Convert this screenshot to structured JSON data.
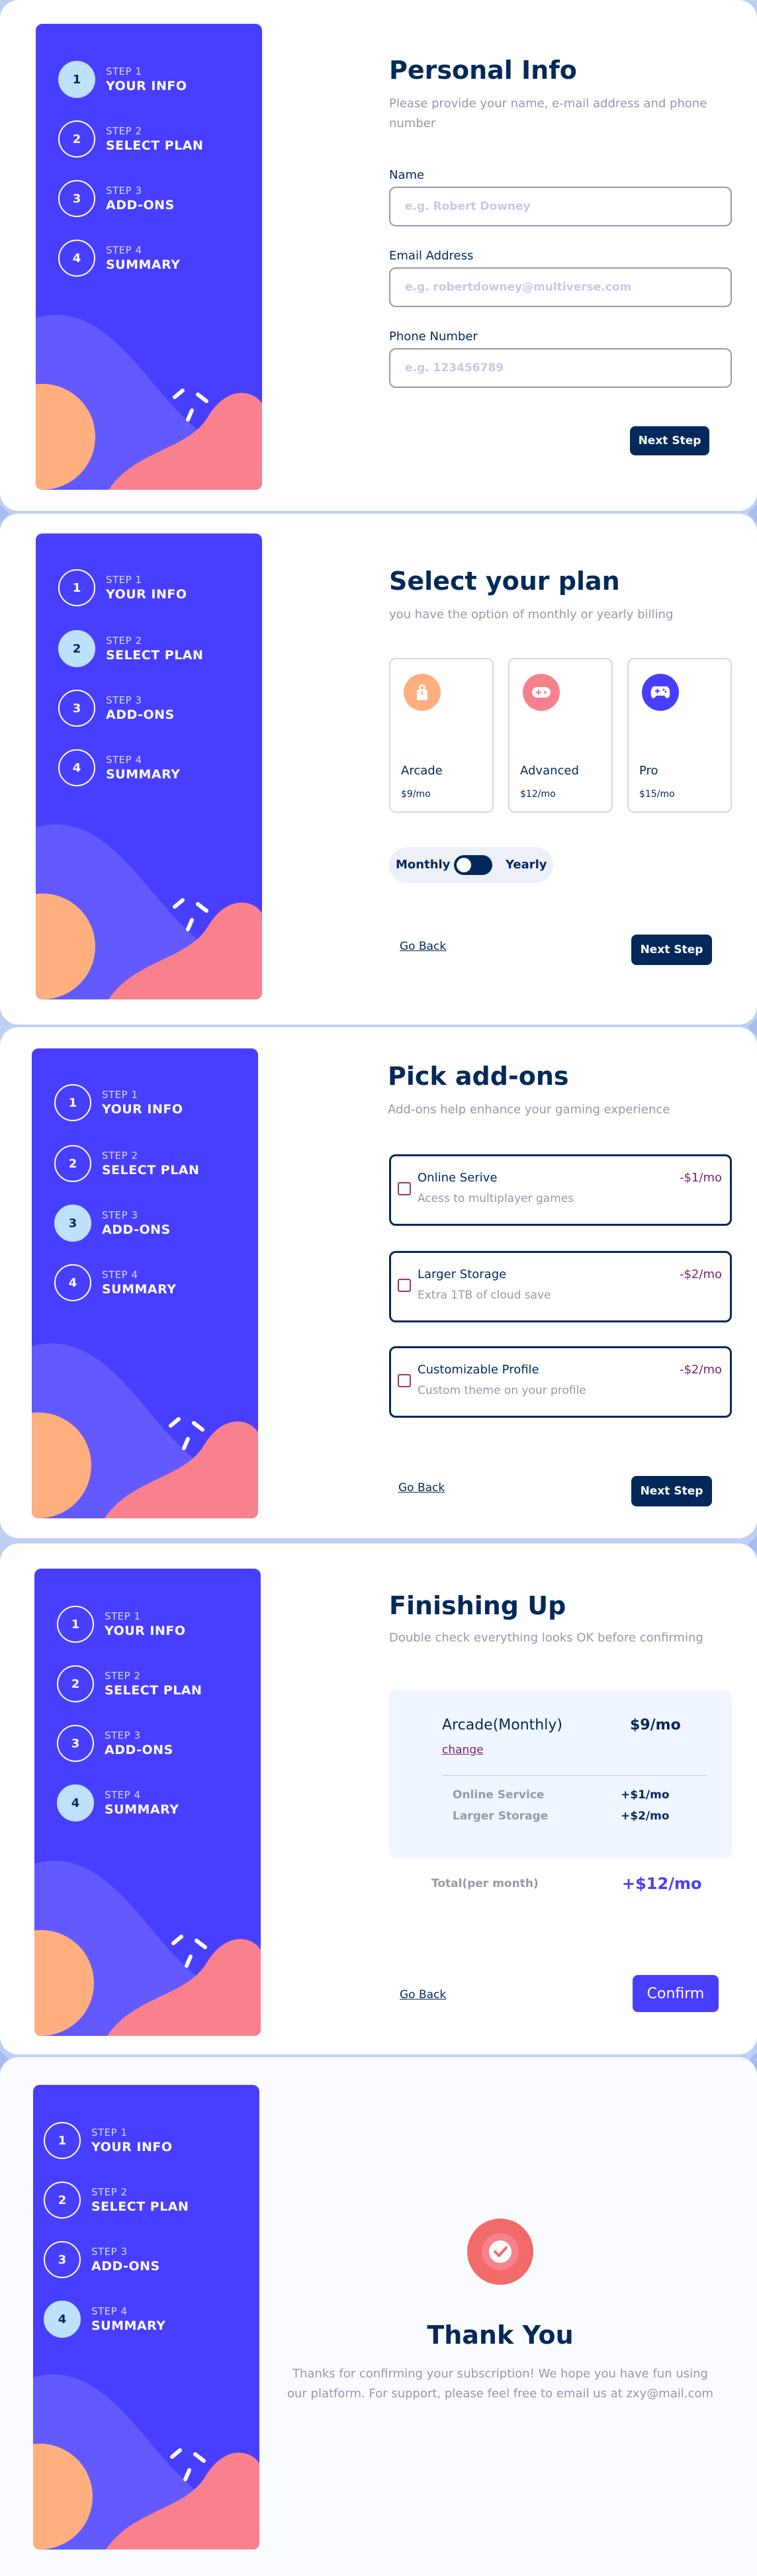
{
  "steps": [
    {
      "step": "STEP 1",
      "title": "YOUR INFO",
      "num": "1"
    },
    {
      "step": "STEP 2",
      "title": "SELECT PLAN",
      "num": "2"
    },
    {
      "step": "STEP 3",
      "title": "ADD-ONS",
      "num": "3"
    },
    {
      "step": "STEP 4",
      "title": "SUMMARY",
      "num": "4"
    }
  ],
  "personal": {
    "title": "Personal Info",
    "subtitle": "Please provide your name, e-mail address and phone number",
    "name_label": "Name",
    "name_placeholder": "e.g. Robert Downey",
    "email_label": "Email Address",
    "email_placeholder": "e.g. robertdowney@multiverse.com",
    "phone_label": "Phone Number",
    "phone_placeholder": "e.g. 123456789",
    "next_label": "Next Step"
  },
  "plan": {
    "title": "Select your plan",
    "subtitle": "you have the option of monthly or yearly billing",
    "options": [
      {
        "name": "Arcade",
        "price": "$9/mo",
        "icon": "arcade-icon",
        "color": "#ffaf7e"
      },
      {
        "name": "Advanced",
        "price": "$12/mo",
        "icon": "advanced-icon",
        "color": "#f9818e"
      },
      {
        "name": "Pro",
        "price": "$15/mo",
        "icon": "pro-icon",
        "color": "#483eff"
      }
    ],
    "monthly_label": "Monthly",
    "yearly_label": "Yearly",
    "back_label": "Go Back",
    "next_label": "Next Step"
  },
  "addons": {
    "title": "Pick add-ons",
    "subtitle": "Add-ons help enhance your gaming experience",
    "items": [
      {
        "name": "Online Serive",
        "desc": "Acess to multiplayer games",
        "price": "-$1/mo"
      },
      {
        "name": "Larger Storage",
        "desc": "Extra 1TB of cloud save",
        "price": "-$2/mo"
      },
      {
        "name": "Customizable Profile",
        "desc": "Custom theme on your profile",
        "price": "-$2/mo"
      }
    ],
    "back_label": "Go Back",
    "next_label": "Next Step"
  },
  "summary": {
    "title": "Finishing Up",
    "subtitle": "Double check everything looks OK before confirming",
    "plan_name": "Arcade(Monthly)",
    "plan_price": "$9/mo",
    "change_label": "change",
    "lines": [
      {
        "name": "Online Service",
        "price": "+$1/mo"
      },
      {
        "name": "Larger Storage",
        "price": "+$2/mo"
      }
    ],
    "total_label": "Total(per month)",
    "total_value": "+$12/mo",
    "back_label": "Go Back",
    "confirm_label": "Confirm"
  },
  "thankyou": {
    "title": "Thank You",
    "message": "Thanks for confirming your subscription! We hope you have fun using our platform. For support, please feel free to email us at zxy@mail.com",
    "icon": "checkmark-icon"
  },
  "colors": {
    "sidebar": "#483eff",
    "active_step": "#bee2fd",
    "navy": "#02295a",
    "orange": "#ffaf7e",
    "pink": "#f9818e",
    "purple": "#7c1e76",
    "page_bg": "#bfd0f5"
  }
}
